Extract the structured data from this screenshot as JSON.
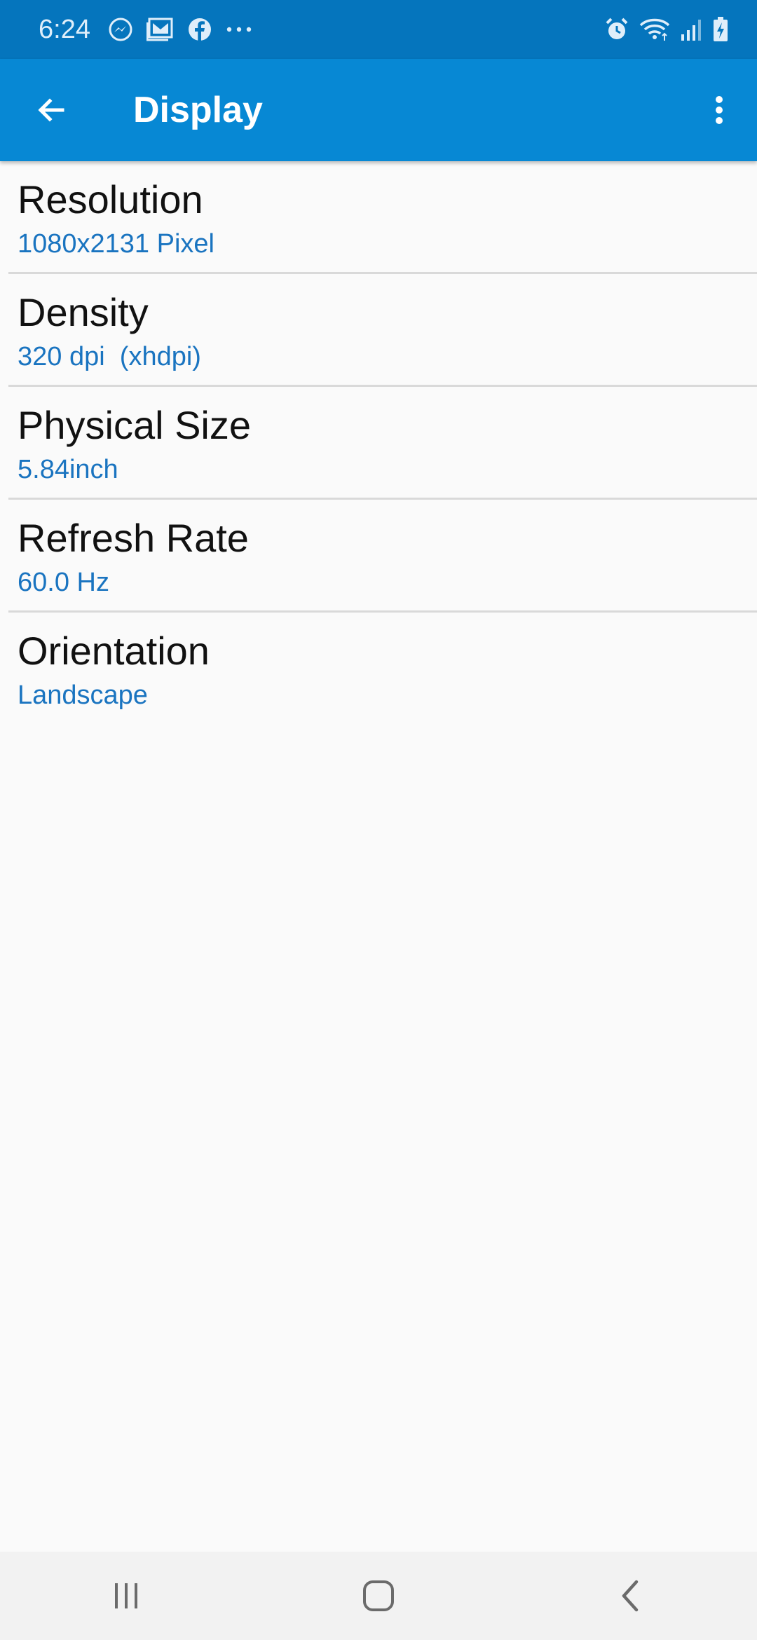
{
  "status_bar": {
    "time": "6:24",
    "left_icons": [
      "messenger-icon",
      "gmail-icon",
      "facebook-icon",
      "more-notifications-icon"
    ],
    "right_icons": [
      "alarm-icon",
      "wifi-icon",
      "cell-signal-icon",
      "battery-charging-icon"
    ]
  },
  "app_bar": {
    "title": "Display",
    "back_icon": "arrow-back-icon",
    "menu_icon": "overflow-menu-icon",
    "background_color": "#0788d4"
  },
  "list": {
    "items": [
      {
        "title": "Resolution",
        "value": "1080x2131 Pixel"
      },
      {
        "title": "Density",
        "value": "320 dpi  (xhdpi)"
      },
      {
        "title": "Physical Size",
        "value": "5.84inch"
      },
      {
        "title": "Refresh Rate",
        "value": "60.0 Hz"
      },
      {
        "title": "Orientation",
        "value": "Landscape"
      }
    ],
    "value_color": "#1a74c0"
  },
  "nav_bar": {
    "buttons": [
      "recents-icon",
      "home-icon",
      "back-icon"
    ]
  }
}
